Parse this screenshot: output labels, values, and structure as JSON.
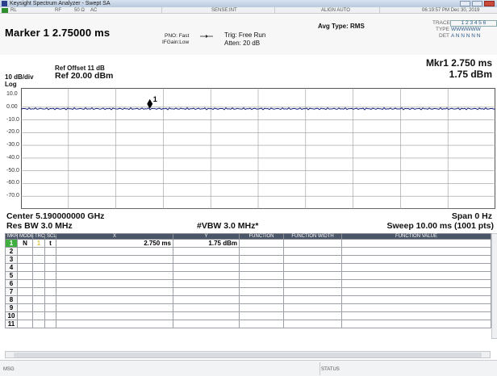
{
  "window": {
    "title": "Keysight Spectrum Analyzer - Swept SA"
  },
  "status_bar": {
    "items": [
      "RL",
      "RF",
      "50 Ω",
      "AC",
      "SENSE:INT",
      "ALIGN AUTO"
    ],
    "datetime": "06:19:57 PM Dec 30, 2019"
  },
  "header": {
    "marker_title": "Marker 1 2.75000 ms",
    "pno": "PNO: Fast",
    "ifgain": "IFGain:Low",
    "trig": "Trig: Free Run",
    "atten": "Atten: 20 dB",
    "avg_type": "Avg Type: RMS",
    "trace_label": "TRACE",
    "trace_values": "1 2 3 4 5 6",
    "type_label": "TYPE",
    "type_values": "WWWWWW",
    "det_label": "DET",
    "det_values": "A N N N N N"
  },
  "graph": {
    "scale": "10 dB/div",
    "scale_type": "Log",
    "ref_offset": "Ref Offset 11 dB",
    "ref_level": "Ref 20.00 dBm",
    "marker_readout_line1": "Mkr1 2.750 ms",
    "marker_readout_line2": "1.75 dBm",
    "marker_label": "1",
    "y_ticks": [
      "10.0",
      "0.00",
      "-10.0",
      "-20.0",
      "-30.0",
      "-40.0",
      "-50.0",
      "-60.0",
      "-70.0"
    ],
    "center": "Center 5.190000000 GHz",
    "span": "Span 0 Hz",
    "res_bw": "Res BW 3.0 MHz",
    "vbw": "#VBW 3.0 MHz*",
    "sweep": "Sweep  10.00 ms (1001 pts)"
  },
  "marker_table": {
    "headers": [
      "MKR",
      "MODE",
      "TRC",
      "SCL",
      "X",
      "Y",
      "FUNCTION",
      "FUNCTION WIDTH",
      "FUNCTION VALUE"
    ],
    "rows": [
      {
        "num": "1",
        "mode": "N",
        "trc": "1",
        "scl": "t",
        "x": "2.750 ms",
        "y": "1.75 dBm"
      },
      {
        "num": "2"
      },
      {
        "num": "3"
      },
      {
        "num": "4"
      },
      {
        "num": "5"
      },
      {
        "num": "6"
      },
      {
        "num": "7"
      },
      {
        "num": "8"
      },
      {
        "num": "9"
      },
      {
        "num": "10"
      },
      {
        "num": "11"
      }
    ]
  },
  "footer": {
    "msg": "MSG",
    "status": "STATUS"
  },
  "colors": {
    "trace": "#1a237e",
    "selected_row": "#3fae3f",
    "table_header": "#4a5568"
  }
}
